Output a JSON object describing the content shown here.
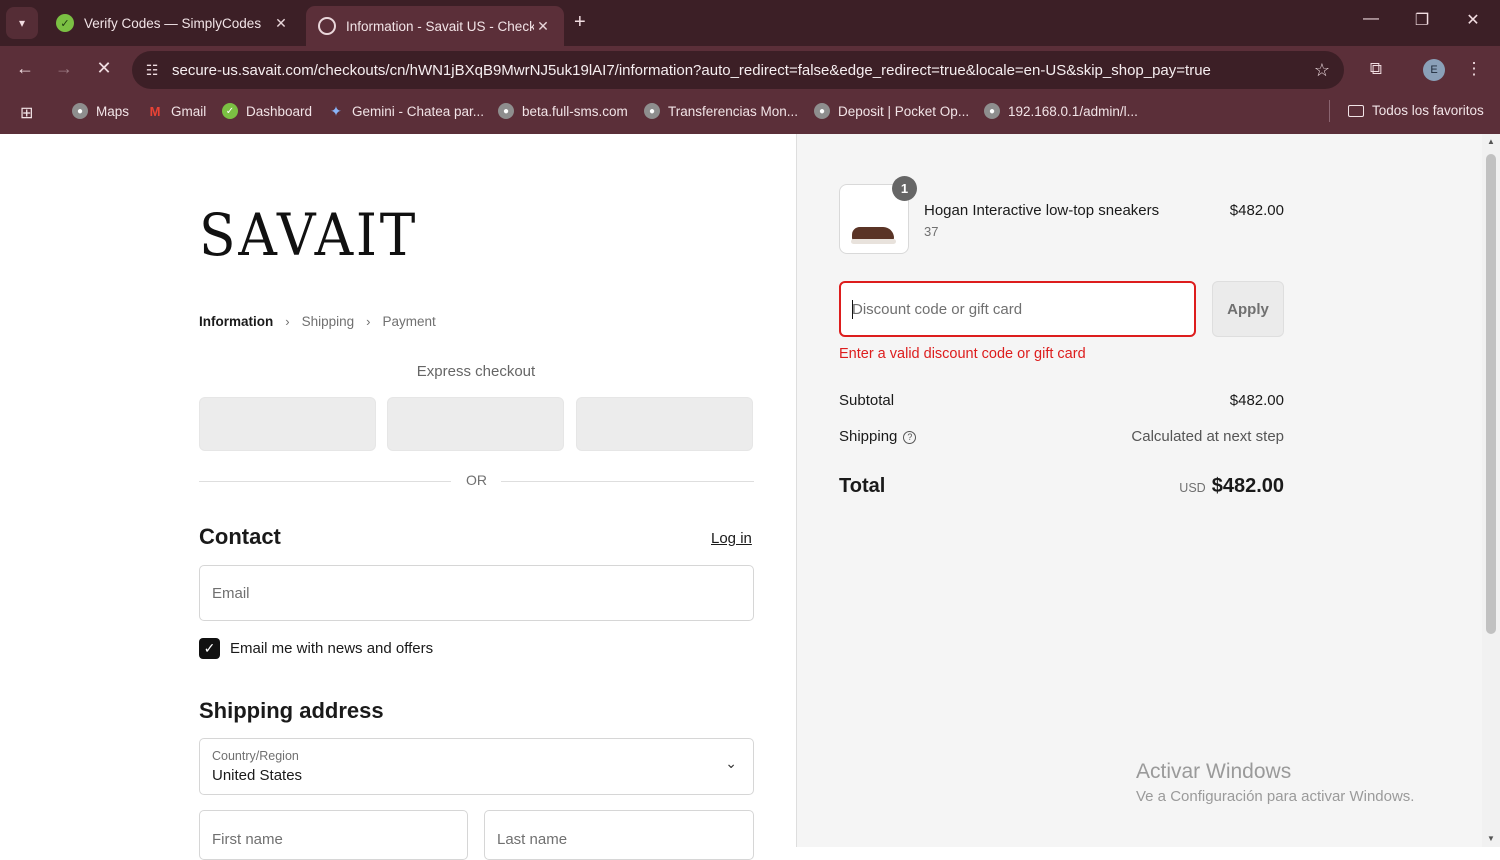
{
  "browser": {
    "tabs": [
      {
        "title": "Verify Codes — SimplyCodes",
        "active": false
      },
      {
        "title": "Information - Savait US - Check",
        "active": true
      }
    ],
    "url": "secure-us.savait.com/checkouts/cn/hWN1jBXqB9MwrNJ5uk19lAI7/information?auto_redirect=false&edge_redirect=true&locale=en-US&skip_shop_pay=true",
    "profile_initial": "E",
    "bookmarks": [
      "Maps",
      "Gmail",
      "Dashboard",
      "Gemini - Chatea par...",
      "beta.full-sms.com",
      "Transferencias Mon...",
      "Deposit | Pocket Op...",
      "192.168.0.1/admin/l...",
      "Todos los favoritos"
    ]
  },
  "checkout": {
    "logo": "SAVAIT",
    "breadcrumbs": [
      "Information",
      "Shipping",
      "Payment"
    ],
    "express_checkout": "Express checkout",
    "or": "OR",
    "contact_heading": "Contact",
    "login": "Log in",
    "email_placeholder": "Email",
    "newsletter_label": "Email me with news and offers",
    "newsletter_checked": true,
    "shipping_heading": "Shipping address",
    "country_label": "Country/Region",
    "country_value": "United States",
    "first_name_placeholder": "First name",
    "last_name_placeholder": "Last name"
  },
  "summary": {
    "item": {
      "quantity": "1",
      "name": "Hogan Interactive low-top sneakers",
      "variant": "37",
      "price": "$482.00"
    },
    "discount_placeholder": "Discount code or gift card",
    "apply_label": "Apply",
    "error": "Enter a valid discount code or gift card",
    "subtotal_label": "Subtotal",
    "subtotal_value": "$482.00",
    "shipping_label": "Shipping",
    "shipping_value": "Calculated at next step",
    "total_label": "Total",
    "total_currency": "USD",
    "total_value": "$482.00"
  },
  "watermark": {
    "line1": "Activar Windows",
    "line2": "Ve a Configuración para activar Windows."
  }
}
